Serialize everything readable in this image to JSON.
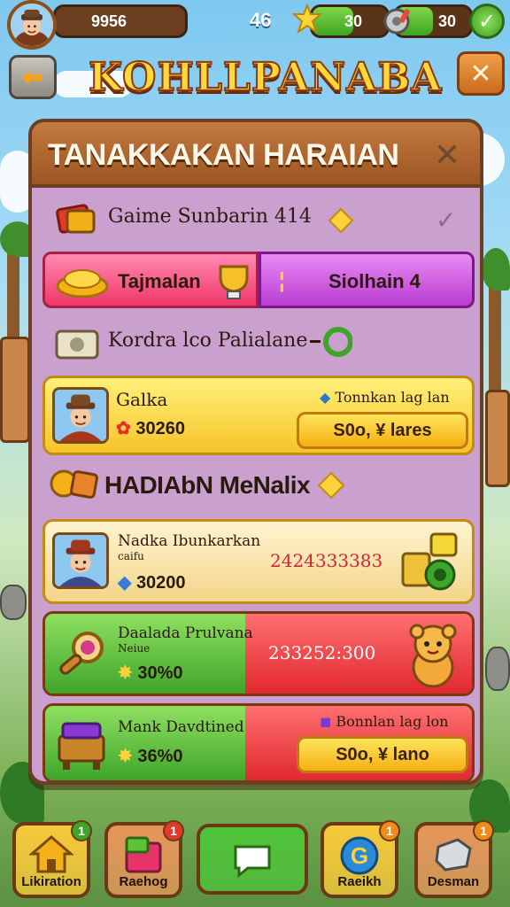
{
  "top_bar": {
    "coins": "9956",
    "level": "46",
    "resource_1": "30",
    "resource_1_fill": 0.55,
    "resource_2": "30",
    "resource_2_fill": 0.5
  },
  "header": {
    "game_title": "KOHLLPANABA"
  },
  "panel": {
    "title": "TANAKKAKAN HARAIAN",
    "game_row_label": "Gaime Sunbarin 414",
    "tab_left_label": "Tajmalan",
    "tab_right_label": "Siolhain 4",
    "section_label": "Kordra lco Palialane",
    "player_card": {
      "name": "Galka",
      "value": "30260",
      "hint": "Tonnkan lag lan",
      "button_label": "S0o, ¥ lares"
    },
    "rewards_heading": "HADIAbN MeNalix",
    "rewards": [
      {
        "title": "Nadka Ibunkarkan",
        "subtitle": "caifu",
        "amount": "30200",
        "right_text": "2424333383"
      },
      {
        "title": "Daalada Prulvana",
        "subtitle": "Neiue",
        "amount": "30%0",
        "right_text": "233252:300"
      },
      {
        "title": "Mank Davdtined",
        "amount": "36%0",
        "hint": "Bonnlan lag lon",
        "button_label": "S0o, ¥ lano"
      }
    ]
  },
  "bottom_bar": [
    {
      "label": "Likiration",
      "badge": "1",
      "color": "#f6c83a"
    },
    {
      "label": "Raehog",
      "badge": "1",
      "color": "#e6955a"
    },
    {
      "label": "",
      "color": "#4fc23a"
    },
    {
      "label": "Raeikh",
      "badge": "1",
      "color": "#f6c83a"
    },
    {
      "label": "Desman",
      "badge": "1",
      "color": "#e6955a"
    }
  ]
}
